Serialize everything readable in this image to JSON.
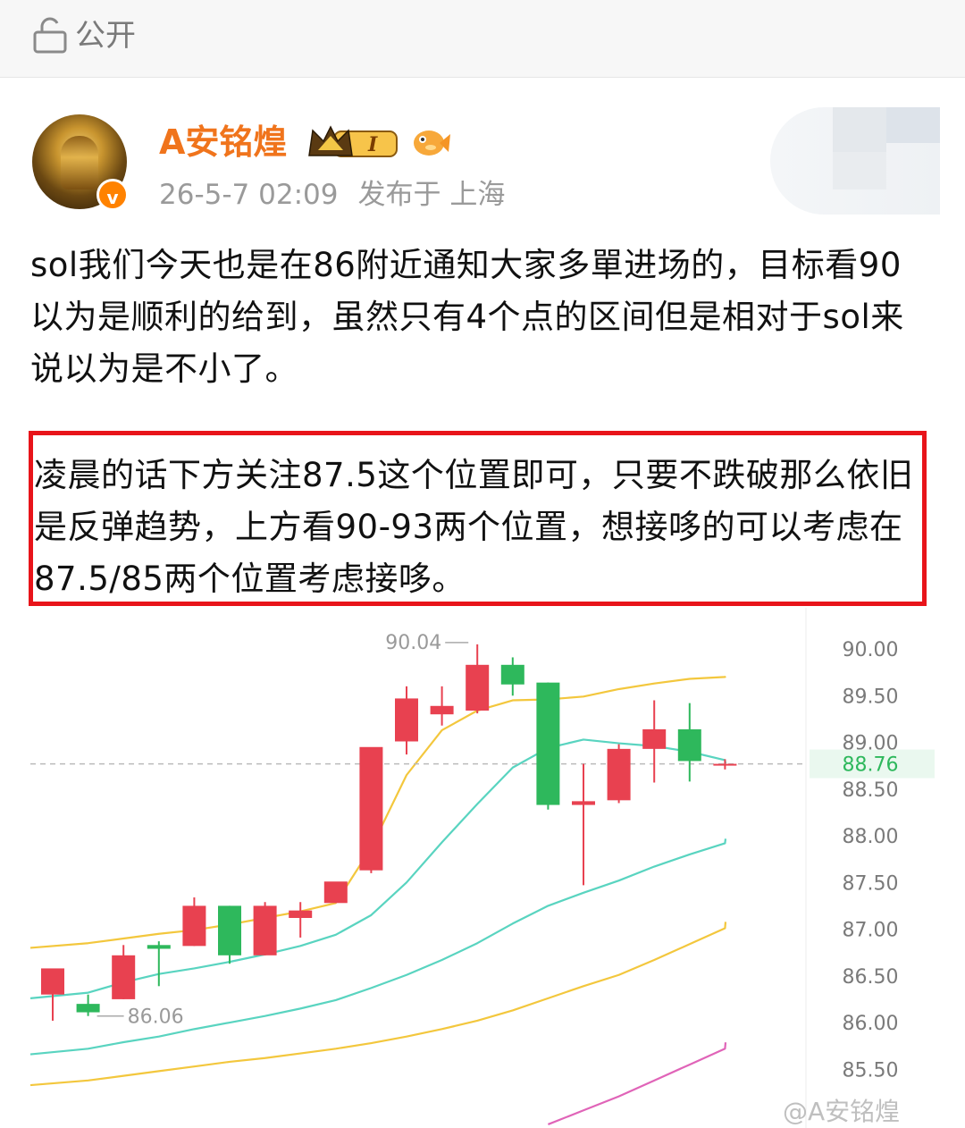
{
  "topbar": {
    "visibility_label": "公开"
  },
  "post": {
    "username": "A安铭煌",
    "badge_level": "I",
    "timestamp": "26-5-7 02:09",
    "location": "发布于 上海",
    "paragraph1": "sol我们今天也是在86附近通知大家多單进场的，目标看90以为是顺利的给到，虽然只有4个点的区间但是相对于sol来说以为是不小了。",
    "paragraph2": "凌晨的话下方关注87.5这个位置即可，只要不跌破那么依旧是反弹趋势，上方看90-93两个位置，想接哆的可以考虑在87.5/85两个位置考虑接哆。",
    "highlight_color": "#e8141a"
  },
  "chart_data": {
    "type": "candlestick",
    "ylim": [
      85.2,
      90.45
    ],
    "y_ticks": [
      "90.00",
      "89.50",
      "89.00",
      "88.50",
      "88.00",
      "87.50",
      "87.00",
      "86.50",
      "86.00",
      "85.50"
    ],
    "current_price": "88.76",
    "high_label": "90.04",
    "low_label": "86.06",
    "up_color": "#e84150",
    "down_color": "#2eb85c",
    "candles": [
      {
        "o": 86.29,
        "h": 86.38,
        "l": 86.01,
        "c": 86.57
      },
      {
        "o": 86.19,
        "h": 86.29,
        "l": 86.06,
        "c": 86.1
      },
      {
        "o": 86.24,
        "h": 86.82,
        "l": 86.24,
        "c": 86.71
      },
      {
        "o": 86.82,
        "h": 86.86,
        "l": 86.38,
        "c": 86.78
      },
      {
        "o": 86.81,
        "h": 87.33,
        "l": 86.81,
        "c": 87.24
      },
      {
        "o": 87.24,
        "h": 87.24,
        "l": 86.62,
        "c": 86.71
      },
      {
        "o": 86.71,
        "h": 87.28,
        "l": 86.71,
        "c": 87.24
      },
      {
        "o": 87.11,
        "h": 87.28,
        "l": 86.9,
        "c": 87.19
      },
      {
        "o": 87.27,
        "h": 87.44,
        "l": 87.27,
        "c": 87.5
      },
      {
        "o": 87.62,
        "h": 88.88,
        "l": 87.59,
        "c": 88.94
      },
      {
        "o": 89.0,
        "h": 89.59,
        "l": 88.86,
        "c": 89.46
      },
      {
        "o": 89.29,
        "h": 89.59,
        "l": 89.17,
        "c": 89.38
      },
      {
        "o": 89.33,
        "h": 90.04,
        "l": 89.3,
        "c": 89.82
      },
      {
        "o": 89.82,
        "h": 89.9,
        "l": 89.49,
        "c": 89.61
      },
      {
        "o": 89.63,
        "h": 89.63,
        "l": 88.27,
        "c": 88.32
      },
      {
        "o": 88.32,
        "h": 88.76,
        "l": 87.46,
        "c": 88.36
      },
      {
        "o": 88.37,
        "h": 88.97,
        "l": 88.34,
        "c": 88.92
      },
      {
        "o": 88.92,
        "h": 89.44,
        "l": 88.56,
        "c": 89.13
      },
      {
        "o": 89.13,
        "h": 89.41,
        "l": 88.57,
        "c": 88.79
      },
      {
        "o": 88.76,
        "h": 88.81,
        "l": 88.7,
        "c": 88.76
      }
    ],
    "ma_lines": [
      {
        "color": "#f3c73d",
        "values": [
          86.79,
          86.84,
          86.89,
          86.94,
          86.98,
          87.04,
          87.11,
          87.18,
          87.27,
          87.86,
          88.64,
          89.12,
          89.33,
          89.44,
          89.45,
          89.48,
          89.56,
          89.62,
          89.67,
          89.69
        ]
      },
      {
        "color": "#59d4c0",
        "values": [
          86.25,
          86.31,
          86.42,
          86.51,
          86.57,
          86.64,
          86.72,
          86.81,
          86.93,
          87.14,
          87.49,
          87.92,
          88.33,
          88.72,
          88.93,
          89.02,
          88.98,
          88.95,
          88.89,
          88.8
        ]
      },
      {
        "color": "#59d4c0",
        "values": [
          85.65,
          85.71,
          85.78,
          85.84,
          85.92,
          85.99,
          86.06,
          86.14,
          86.23,
          86.36,
          86.5,
          86.66,
          86.84,
          87.05,
          87.24,
          87.38,
          87.51,
          87.66,
          87.79,
          87.91
        ]
      },
      {
        "color": "#f3c73d",
        "values": [
          85.32,
          85.37,
          85.42,
          85.47,
          85.52,
          85.57,
          85.61,
          85.66,
          85.71,
          85.77,
          85.84,
          85.92,
          86.01,
          86.12,
          86.25,
          86.38,
          86.5,
          86.66,
          86.83,
          87.0
        ]
      },
      {
        "color": "#e064b8",
        "values": [
          null,
          null,
          null,
          null,
          null,
          null,
          null,
          null,
          null,
          null,
          null,
          null,
          null,
          null,
          84.9,
          85.05,
          85.2,
          85.37,
          85.54,
          85.71
        ]
      }
    ]
  },
  "watermark": {
    "text": "@A安铭煌"
  }
}
